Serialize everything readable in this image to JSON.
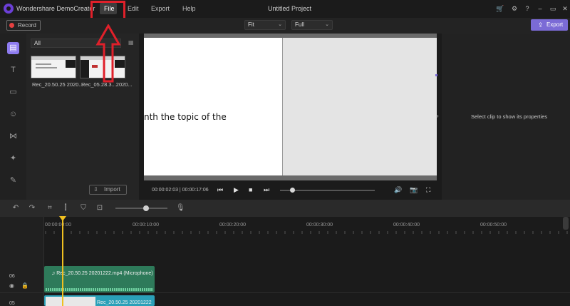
{
  "app": {
    "name": "Wondershare DemoCreator",
    "project_title": "Untitled Project",
    "menu": [
      "File",
      "Edit",
      "Export",
      "Help"
    ]
  },
  "toolbar": {
    "record_label": "Record",
    "fit_select": "Fit",
    "quality_select": "Full",
    "export_label": "Export"
  },
  "media": {
    "filter": "All",
    "items": [
      {
        "label": "Rec_20.50.25 2020..."
      },
      {
        "label": "Rec_05.28.3...2020..."
      }
    ],
    "import_label": "Import"
  },
  "preview": {
    "text": "nth the topic of the",
    "time_readout": "00:00:02:03 | 00:00:17:06",
    "seek_progress": 0.13
  },
  "properties": {
    "placeholder": "Select clip to show its properties"
  },
  "timeline": {
    "ticks": [
      "00:00:00:00",
      "00:00:10:00",
      "00:00:20:00",
      "00:00:30:00",
      "00:00:40:00",
      "00:00:50:00"
    ],
    "tracks": [
      {
        "number": "06",
        "clip_label": "Rec_20.50.25 20201222.mp4 (Microphone)"
      },
      {
        "number": "05",
        "clip_label": "Rec_20.50.25 20201222"
      }
    ]
  },
  "colors": {
    "accent": "#7b6bd6",
    "annotation_red": "#e0202a",
    "playhead": "#f0c020",
    "audio_clip": "#2e7a5a",
    "video_clip": "#2aa0b8"
  }
}
